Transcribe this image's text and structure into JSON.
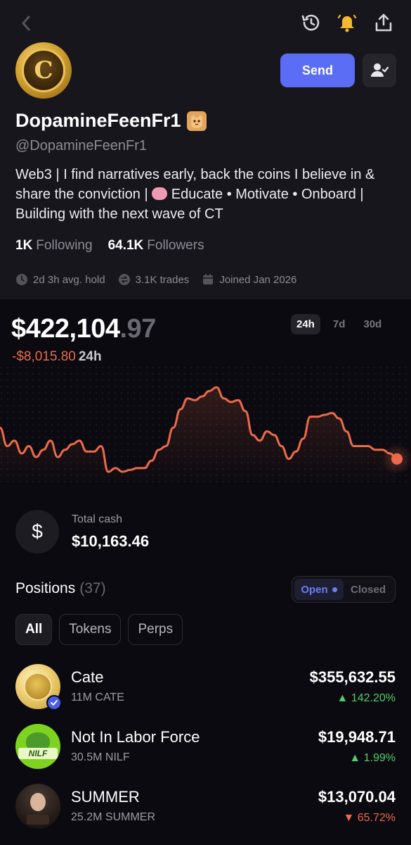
{
  "profile": {
    "display_name": "DopamineFeenFr1",
    "handle": "@DopamineFeenFr1",
    "bio_part1": "Web3 | I find narratives early, back the coins I believe in & share the conviction | ",
    "bio_part2": " Educate • Motivate • Onboard | Building with the next wave of CT",
    "following_count": "1K",
    "following_label": "Following",
    "followers_count": "64.1K",
    "followers_label": "Followers",
    "avg_hold": "2d 3h avg. hold",
    "trades": "3.1K trades",
    "joined": "Joined Jan 2026"
  },
  "actions": {
    "send_label": "Send"
  },
  "portfolio": {
    "balance_main": "$422,104",
    "balance_cents": ".97",
    "change_value": "-$8,015.80",
    "change_period": "24h",
    "timeframes": [
      "24h",
      "7d",
      "30d"
    ],
    "active_timeframe": "24h"
  },
  "cash": {
    "label": "Total cash",
    "value": "$10,163.46"
  },
  "positions": {
    "title": "Positions",
    "count": "(37)",
    "toggle_open": "Open",
    "toggle_closed": "Closed",
    "filters": [
      "All",
      "Tokens",
      "Perps"
    ],
    "items": [
      {
        "name": "Cate",
        "amount": "11M CATE",
        "value": "$355,632.55",
        "change": "142.20%",
        "direction": "up"
      },
      {
        "name": "Not In Labor Force",
        "amount": "30.5M NILF",
        "value": "$19,948.71",
        "change": "1.99%",
        "direction": "up"
      },
      {
        "name": "SUMMER",
        "amount": "25.2M SUMMER",
        "value": "$13,070.04",
        "change": "65.72%",
        "direction": "down"
      }
    ]
  },
  "icons": {
    "back": "chevron-left-icon",
    "history": "history-icon",
    "bell": "bell-icon",
    "share": "share-icon",
    "follow": "user-check-icon"
  },
  "colors": {
    "accent": "#5b6cf5",
    "bell": "#f5b82e",
    "negative": "#ec6a4a",
    "positive": "#4fd06c"
  },
  "chart_data": {
    "type": "line",
    "series": [
      {
        "values": [
          62,
          52,
          55,
          48,
          52,
          46,
          50,
          55,
          46,
          50,
          53,
          55,
          49,
          49,
          52,
          38,
          40,
          38,
          39,
          40,
          40,
          44,
          50,
          52,
          62,
          72,
          78,
          77,
          79,
          82,
          84,
          78,
          76,
          77,
          71,
          58,
          55,
          60,
          58,
          52,
          45,
          49,
          56,
          68,
          68,
          69,
          70,
          67,
          60,
          52,
          52,
          52,
          50,
          50,
          48,
          45
        ]
      }
    ]
  }
}
